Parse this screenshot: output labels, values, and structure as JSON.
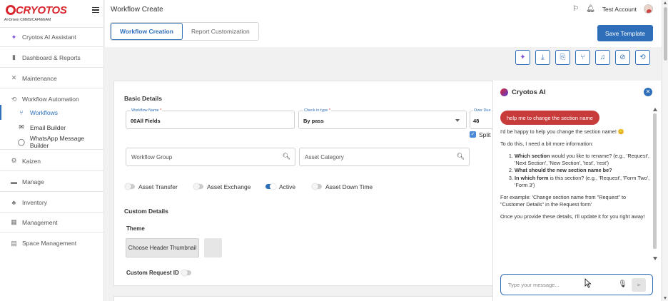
{
  "brand": {
    "name": "CRYOTOS",
    "tagline": "AI-Driven CMMS/CAFM/EAM"
  },
  "sidebar": {
    "items": [
      {
        "label": "Cryotos AI Assistant",
        "icon": "sparkle-icon"
      },
      {
        "label": "Dashboard & Reports",
        "icon": "bar-chart-icon"
      },
      {
        "label": "Maintenance",
        "icon": "tools-icon"
      },
      {
        "label": "Workflow Automation",
        "icon": "workflow-icon"
      },
      {
        "label": "Kaizen",
        "icon": "cog-icon"
      },
      {
        "label": "Manage",
        "icon": "cart-icon"
      },
      {
        "label": "Inventory",
        "icon": "inventory-icon"
      },
      {
        "label": "Management",
        "icon": "grid-icon"
      },
      {
        "label": "Space Management",
        "icon": "building-icon"
      }
    ],
    "subitems": [
      {
        "label": "Workflows",
        "icon": "flow-icon"
      },
      {
        "label": "Email Builder",
        "icon": "mail-icon"
      },
      {
        "label": "WhatsApp Message Builder",
        "icon": "whatsapp-icon"
      }
    ]
  },
  "header": {
    "title": "Workflow Create",
    "user": "Test Account",
    "tabs": [
      "Workflow Creation",
      "Report Customization"
    ],
    "save_label": "Save Template"
  },
  "form": {
    "basic_details": "Basic Details",
    "workflow_name": {
      "label": "Workflow Name",
      "value": "00All Fields"
    },
    "check_in_type": {
      "label": "Check in type",
      "value": "By pass"
    },
    "over_due": {
      "label": "Over Due",
      "value": "48"
    },
    "split_label": "Split",
    "workflow_group_ph": "Workflow Group",
    "asset_category_ph": "Asset Category",
    "toggles": [
      {
        "label": "Asset Transfer",
        "on": false
      },
      {
        "label": "Asset Exchange",
        "on": false
      },
      {
        "label": "Active",
        "on": true
      },
      {
        "label": "Asset Down Time",
        "on": false
      }
    ],
    "custom_details": "Custom Details",
    "theme": "Theme",
    "choose_thumb": "Choose Header Thumbnail",
    "custom_request_id": "Custom Request ID"
  },
  "chat": {
    "title": "Cryotos AI",
    "user_message": "help me to change the section name",
    "reply_intro": "I'd be happy to help you change the section name! 😊",
    "reply_need": "To do this, I need a bit more information:",
    "q1_bold": "Which section",
    "q1_rest": " would you like to rename? (e.g., 'Request', 'Next Section', 'New Section', 'test', 'rest')",
    "q2_bold": "What should the new section name be?",
    "q3_bold": "In which form",
    "q3_rest": " is this section? (e.g., 'Request', 'Form Two', 'Form 3')",
    "example": "For example: 'Change section name from \"Request\" to \"Customer Details\" in the Request form'",
    "closing": "Once you provide these details, I'll update it for you right away!",
    "input_placeholder": "Type your message..."
  }
}
